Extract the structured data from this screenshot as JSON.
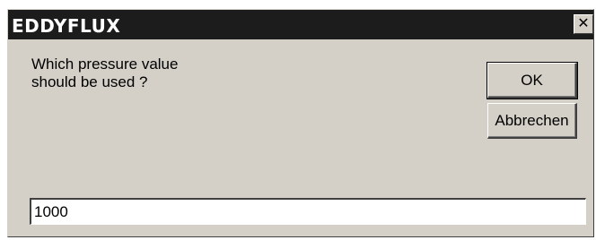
{
  "window": {
    "title": "EDDYFLUX",
    "close_glyph": "✕",
    "close_icon": "close-icon"
  },
  "dialog": {
    "prompt": "Which pressure value\nshould be used ?",
    "ok_label": "OK",
    "cancel_label": "Abbrechen",
    "input_value": "1000"
  },
  "colors": {
    "titlebar": "#1c1c1c",
    "dialog_bg": "#d4d0c8",
    "input_bg": "#ffffff"
  }
}
